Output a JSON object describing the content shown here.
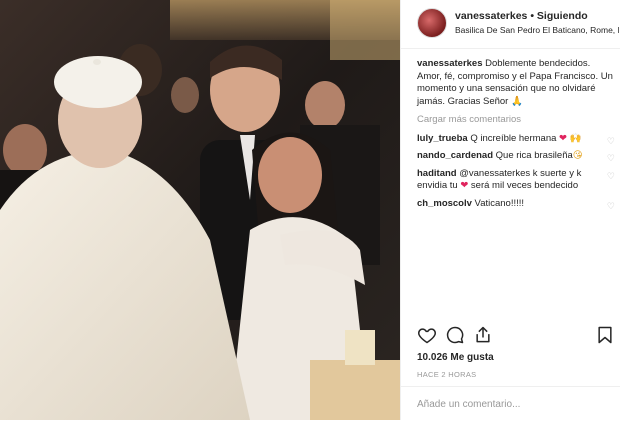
{
  "post": {
    "username": "vanessaterkes",
    "separator": " • ",
    "follow_label": "Siguiendo",
    "location": "Basilica De San Pedro El Baticano, Rome, It...",
    "caption_user": "vanessaterkes",
    "caption_text": " Doblemente bendecidos. Amor, fé, compromiso y el Papa Francisco. Un momento y una sensación que no olvidaré jamás. Gracias Señor 🙏",
    "load_more": "Cargar más comentarios",
    "comments": [
      {
        "user": "luly_trueba",
        "text": " Q increíble hermana ",
        "emoji": "❤ 🙌"
      },
      {
        "user": "nando_cardenad",
        "text": " Que rica brasileña",
        "emoji": "😘"
      },
      {
        "user": "haditand",
        "text": " @vanessaterkes k suerte y k envidia tu ",
        "emoji": "❤",
        "text2": " será mil veces bendecido"
      },
      {
        "user": "ch_moscolv",
        "text": " Vaticano!!!!!",
        "emoji": ""
      }
    ],
    "likes": "10.026 Me gusta",
    "time": "HACE 2 HORAS",
    "comment_placeholder": "Añade un comentario..."
  },
  "colors": {
    "text": "#262626",
    "muted": "#999999",
    "border": "#efefef",
    "heart": "#e0245e"
  },
  "icons": [
    "heart-icon",
    "comment-icon",
    "share-icon",
    "bookmark-icon"
  ]
}
